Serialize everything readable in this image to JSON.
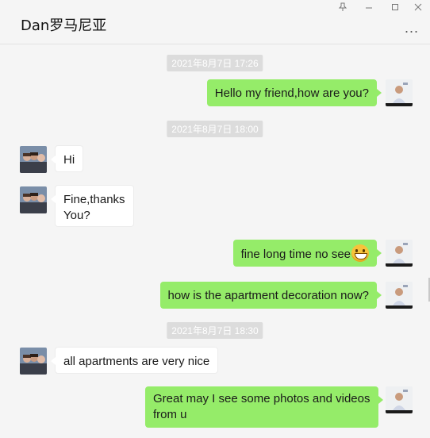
{
  "window": {
    "title": "Dan罗马尼亚",
    "more_label": "..."
  },
  "icons": {
    "pin": "pin-icon",
    "minimize": "minimize-icon",
    "maximize": "maximize-icon",
    "close": "close-icon",
    "more": "more-icon"
  },
  "colors": {
    "my_bubble": "#95ec69",
    "their_bubble": "#ffffff",
    "background": "#f5f5f5",
    "timestamp_bg": "#dcdcdc"
  },
  "messages": {
    "t1": "2021年8月7日 17:26",
    "m1": "Hello my friend,how are you?",
    "t2": "2021年8月7日 18:00",
    "m2": "Hi",
    "m3_line1": "Fine,thanks",
    "m3_line2": "You?",
    "m4": "fine long time no see",
    "m5": "how is the apartment decoration now?",
    "t3": "2021年8月7日 18:30",
    "m6": "all apartments are very nice",
    "m7_line1": "Great may I see some photos and videos",
    "m7_line2": "from u"
  }
}
